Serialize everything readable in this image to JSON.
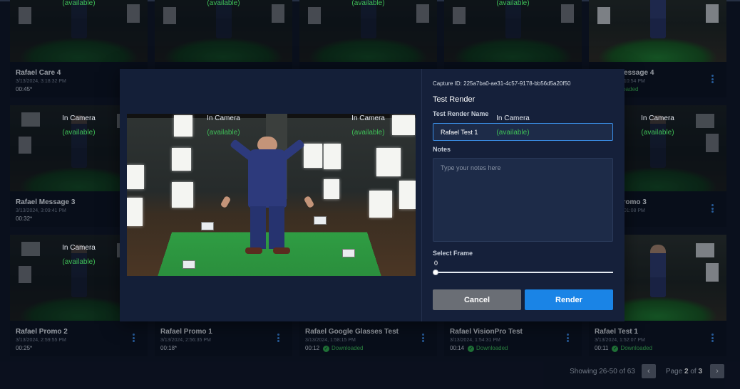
{
  "grid": {
    "cards": [
      {
        "name": "Rafael Care 4",
        "date": "3/13/2024, 3:18:32 PM",
        "duration": "00:45*",
        "status": "in-camera",
        "downloaded": false
      },
      {
        "name": "",
        "date": "",
        "duration": "",
        "status": "in-camera",
        "downloaded": false
      },
      {
        "name": "",
        "date": "",
        "duration": "",
        "status": "in-camera",
        "downloaded": false
      },
      {
        "name": "",
        "date": "",
        "duration": "",
        "status": "in-camera",
        "downloaded": false
      },
      {
        "name": "Rafael Message 4",
        "date": "3/13/2024, 3:10:54 PM",
        "duration": "",
        "status": "downloaded",
        "downloaded": true
      },
      {
        "name": "Rafael Message 3",
        "date": "3/13/2024, 3:09:41 PM",
        "duration": "00:32*",
        "status": "in-camera",
        "downloaded": false
      },
      {
        "name": "",
        "date": "",
        "duration": "",
        "status": "in-camera",
        "downloaded": false
      },
      {
        "name": "",
        "date": "",
        "duration": "",
        "status": "in-camera",
        "downloaded": false
      },
      {
        "name": "",
        "date": "",
        "duration": "",
        "status": "in-camera",
        "downloaded": false
      },
      {
        "name": "Rafael Promo 3",
        "date": "3/13/2024, 3:01:08 PM",
        "duration": "",
        "status": "in-camera",
        "downloaded": false
      },
      {
        "name": "Rafael Promo 2",
        "date": "3/13/2024, 2:59:55 PM",
        "duration": "00:25*",
        "status": "in-camera",
        "downloaded": false
      },
      {
        "name": "Rafael Promo 1",
        "date": "3/13/2024, 2:56:35 PM",
        "duration": "00:18*",
        "status": "none",
        "downloaded": false
      },
      {
        "name": "Rafael Google Glasses Test",
        "date": "3/13/2024, 1:58:15 PM",
        "duration": "00:12",
        "status": "downloaded",
        "downloaded": true
      },
      {
        "name": "Rafael VisionPro Test",
        "date": "3/13/2024, 1:54:31 PM",
        "duration": "00:14",
        "status": "downloaded",
        "downloaded": true
      },
      {
        "name": "Rafael Test 1",
        "date": "3/13/2024, 1:52:07 PM",
        "duration": "00:11",
        "status": "downloaded",
        "downloaded": true
      }
    ],
    "in_camera_label": "In Camera",
    "available_label": "(available)",
    "downloaded_label": "Downloaded"
  },
  "pagination": {
    "showing": "Showing 26-50 of 63",
    "page_prefix": "Page",
    "page_current": "2",
    "page_of": "of",
    "page_total": "3",
    "prev_icon": "‹",
    "next_icon": "›"
  },
  "modal": {
    "capture_id": "Capture ID: 225a7ba0-ae31-4c57-9178-bb56d5a20f50",
    "section_title": "Test Render",
    "name_label": "Test Render Name",
    "name_value": "Rafael Test 1",
    "notes_label": "Notes",
    "notes_placeholder": "Type your notes here",
    "frame_label": "Select Frame",
    "frame_value": "0",
    "frame_fraction": 0,
    "cancel_label": "Cancel",
    "render_label": "Render"
  },
  "colors": {
    "accent": "#1a84e6",
    "downloaded": "#3fbf57",
    "kebab": "#3a87e0"
  }
}
